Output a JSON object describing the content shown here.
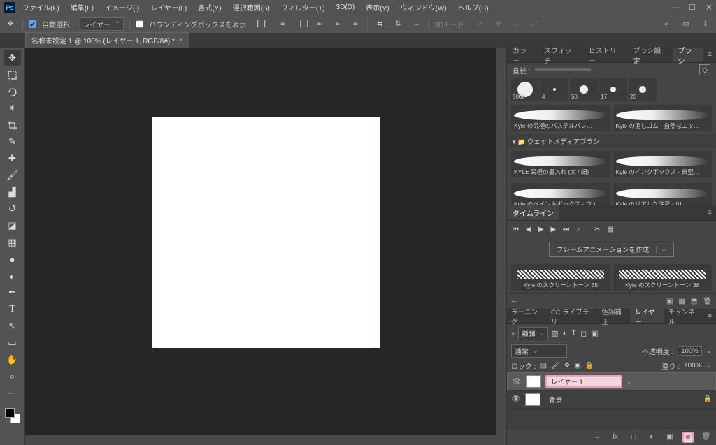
{
  "menubar": {
    "items": [
      "ファイル(F)",
      "編集(E)",
      "イメージ(I)",
      "レイヤー(L)",
      "書式(Y)",
      "選択範囲(S)",
      "フィルター(T)",
      "3D(D)",
      "表示(V)",
      "ウィンドウ(W)",
      "ヘルプ(H)"
    ]
  },
  "options": {
    "autoSelect": "自動選択 :",
    "autoSelectTarget": "レイヤー",
    "showTransform": "バウンディングボックスを表示",
    "mode3d": "3Dモード :"
  },
  "docTab": "名称未設定 1 @ 100% (レイヤー 1, RGB/8#) *",
  "panels": {
    "colorTabs": [
      "カラー",
      "スウォッチ",
      "ヒストリー",
      "ブラシ設定",
      "ブラシ"
    ],
    "brush": {
      "diameter": "直径 :",
      "presets": [
        {
          "size": "5000"
        },
        {
          "size": "4"
        },
        {
          "size": "50"
        },
        {
          "size": "17"
        },
        {
          "size": "20"
        }
      ],
      "big": [
        "Kyle の究極のパステルパレ…",
        "Kyle の消しゴム - 自然なエッ…"
      ],
      "folder": "ウェットメディアブラシ",
      "folderItems": [
        "KYLE 究極の墨入れ (太 / 細)",
        "Kyle のインクボックス - 典型…",
        "Kyle のペイントボックス - ウェ…",
        "Kyle のリアルな油彩 - 01"
      ]
    },
    "timeline": {
      "tab": "タイムライン",
      "button": "フレームアニメーションを作成"
    },
    "brushGroup": [
      "Kyle のスクリーントーン 35",
      "Kyle のスクリーントーン 38"
    ],
    "layersTabs": [
      "ラーニング",
      "CC ライブラリ",
      "色調補正",
      "レイヤー",
      "チャンネル"
    ],
    "layers": {
      "kind": "種類",
      "blend": "通常",
      "opacityLabel": "不透明度 :",
      "opacity": "100%",
      "lockLabel": "ロック :",
      "fillLabel": "塗り :",
      "fill": "100%",
      "items": [
        {
          "name": "レイヤー 1",
          "highlight": true,
          "locked": false
        },
        {
          "name": "背景",
          "highlight": false,
          "locked": true
        }
      ]
    }
  }
}
